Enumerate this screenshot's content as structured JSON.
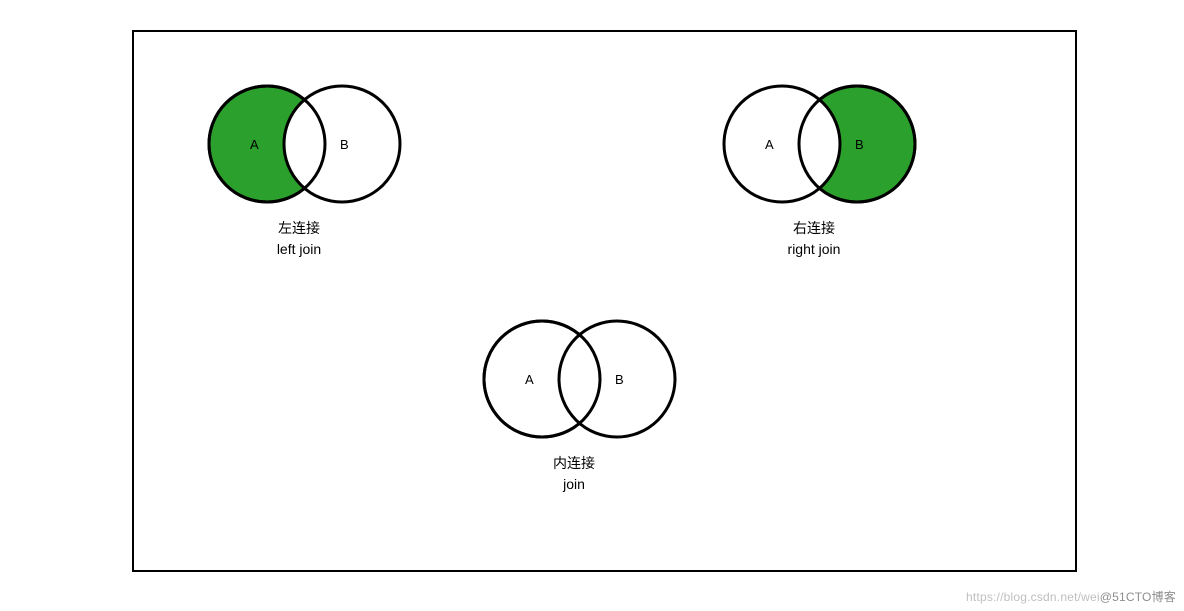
{
  "diagrams": {
    "left_join": {
      "labelA": "A",
      "labelB": "B",
      "title_zh": "左连接",
      "title_en": "left join"
    },
    "right_join": {
      "labelA": "A",
      "labelB": "B",
      "title_zh": "右连接",
      "title_en": "right join"
    },
    "inner_join": {
      "labelA": "A",
      "labelB": "B",
      "title_zh": "内连接",
      "title_en": "join"
    }
  },
  "colors": {
    "fill_green": "#2ca02c",
    "stroke": "#000000",
    "circle_fill_empty": "#ffffff"
  },
  "watermark": {
    "part1": "https://blog.csdn.net/wei",
    "part2": "@51CTO博客"
  }
}
